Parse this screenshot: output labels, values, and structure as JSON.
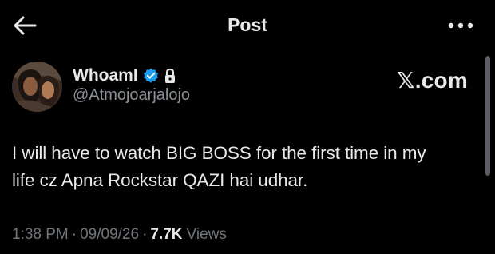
{
  "header": {
    "title": "Post",
    "back_icon": "arrow-left-icon",
    "more_icon": "more-horizontal-icon"
  },
  "author": {
    "display_name": "WhoamI",
    "handle": "@Atmojoarjalojo",
    "verified": true,
    "protected": true,
    "verified_color": "#1d9bf0"
  },
  "source": {
    "brand": "𝕏.com"
  },
  "tweet": {
    "text": "I will have to watch BIG BOSS for the first time in my\nlife cz Apna Rockstar QAZI hai udhar."
  },
  "meta": {
    "time": "1:38 PM",
    "date": "09/09/26",
    "views_count": "7.7K",
    "views_label": "Views"
  },
  "colors": {
    "background": "#000000",
    "text_primary": "#e7e9ea",
    "text_secondary": "#71767b"
  }
}
